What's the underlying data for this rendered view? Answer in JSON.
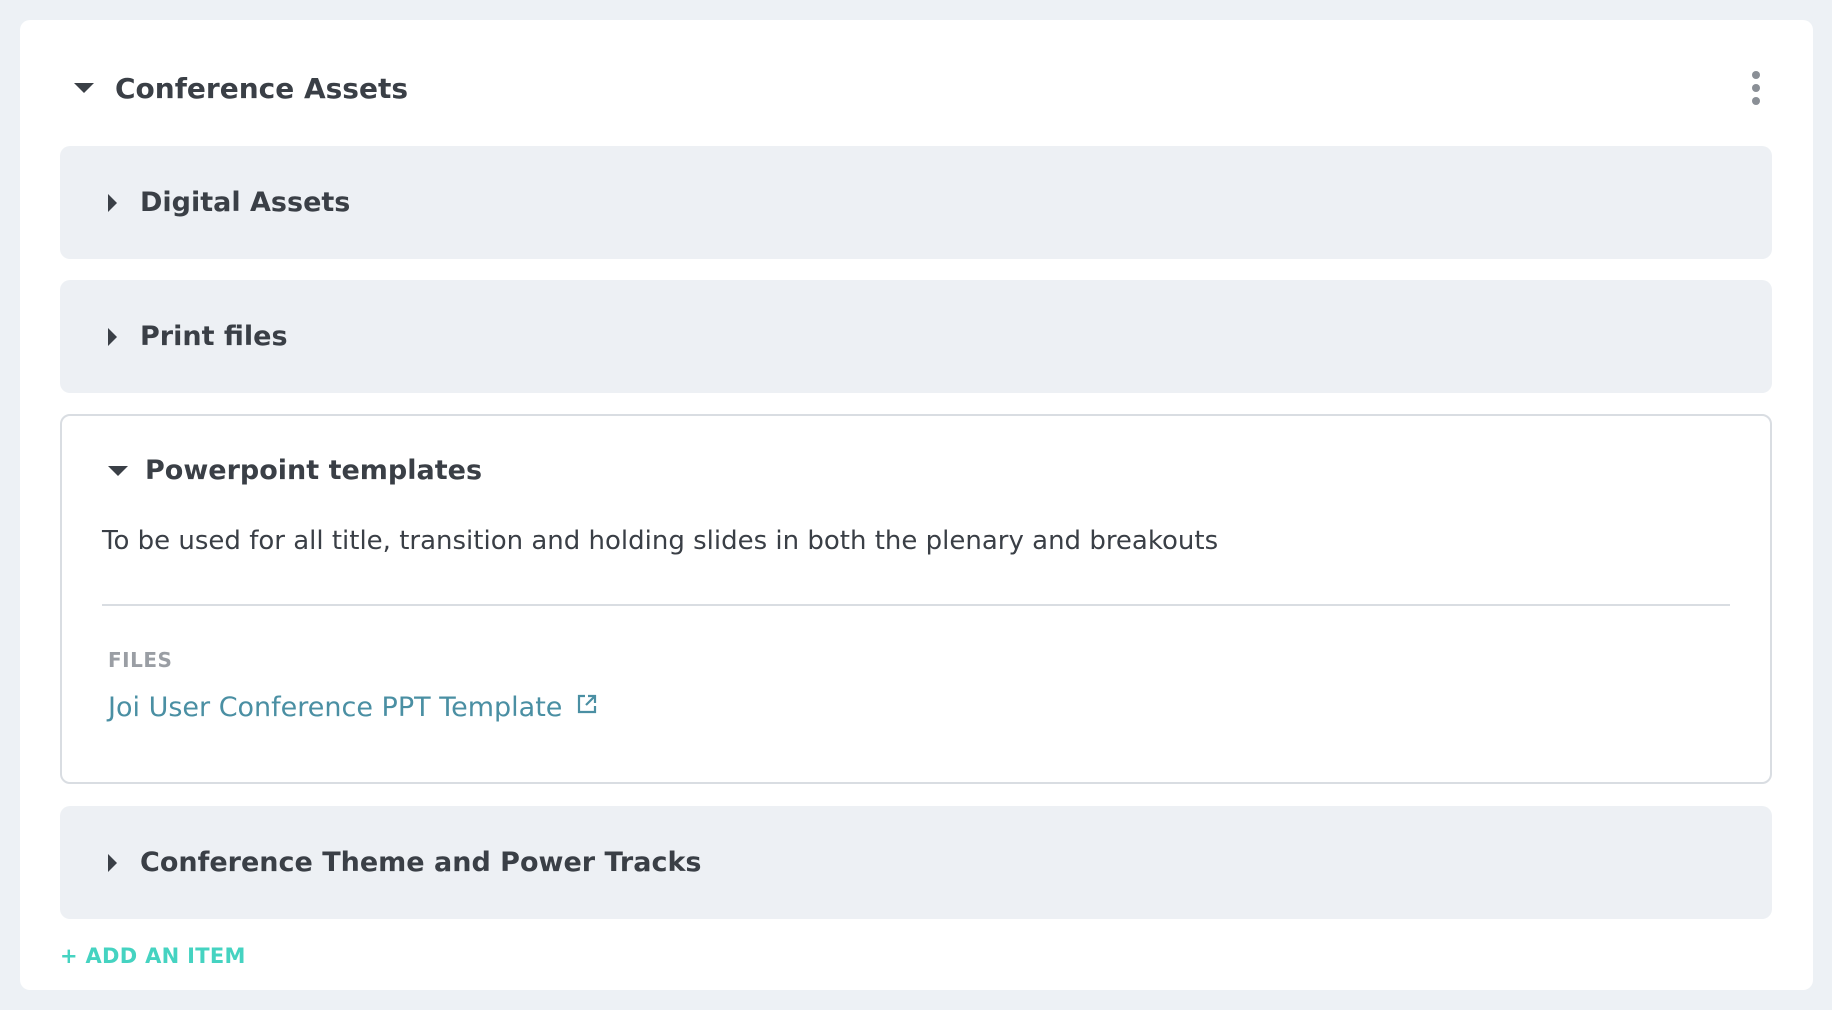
{
  "section": {
    "title": "Conference Assets",
    "menu_icon": "kebab-menu-icon",
    "collapse_icon": "caret-down-icon"
  },
  "items": [
    {
      "title": "Digital Assets",
      "state": "collapsed",
      "icon": "caret-right-icon"
    },
    {
      "title": "Print files",
      "state": "collapsed",
      "icon": "caret-right-icon"
    },
    {
      "title": "Powerpoint templates",
      "state": "expanded",
      "icon": "caret-down-icon",
      "description": "To be used for all title, transition and holding slides in both the plenary and breakouts",
      "files_label": "FILES",
      "files": [
        {
          "name": "Joi User Conference PPT Template",
          "icon": "external-link-icon"
        }
      ]
    },
    {
      "title": "Conference Theme and Power Tracks",
      "state": "collapsed",
      "icon": "caret-right-icon"
    }
  ],
  "add_item_label": "+ ADD AN ITEM",
  "colors": {
    "page_bg": "#edf1f5",
    "card_bg": "#ffffff",
    "collapsed_item_bg": "#edf0f4",
    "text": "#3a3f46",
    "muted": "#9a9ea4",
    "link": "#4a8fa3",
    "accent": "#45d3c1"
  }
}
